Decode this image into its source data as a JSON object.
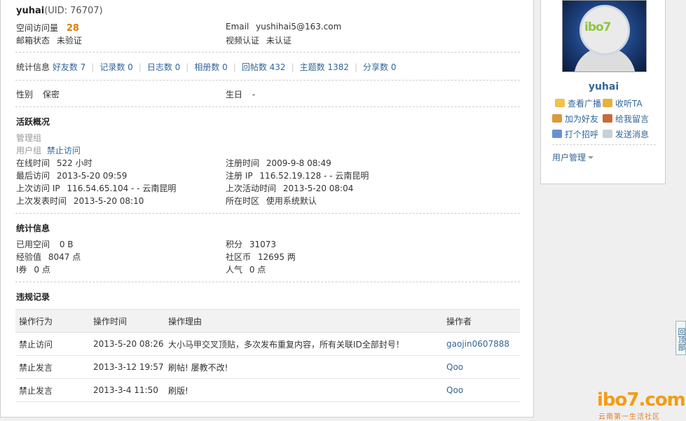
{
  "profile": {
    "username": "yuhai",
    "uid_text": "(UID: 76707)",
    "space_visits_label": "空间访问量",
    "space_visits_value": "28",
    "email_label": "Email",
    "email_value": "yushihai5@163.com",
    "email_status_label": "邮箱状态",
    "email_status_value": "未验证",
    "video_label": "视频认证",
    "video_value": "未认证"
  },
  "stats_line": {
    "label": "统计信息",
    "items": [
      "好友数 7",
      "记录数 0",
      "日志数 0",
      "相册数 0",
      "回帖数 432",
      "主题数 1382",
      "分享数 0"
    ]
  },
  "basic": {
    "gender_label": "性别",
    "gender_value": "保密",
    "birthday_label": "生日",
    "birthday_value": "-"
  },
  "activity": {
    "title": "活跃概况",
    "admin_group_label": "管理组",
    "user_group_label": "用户组",
    "user_group_value": "禁止访问",
    "online_label": "在线时间",
    "online_value": "522 小时",
    "register_label": "注册时间",
    "register_value": "2009-9-8 08:49",
    "last_visit_label": "最后访问",
    "last_visit_value": "2013-5-20 09:59",
    "register_ip_label": "注册 IP",
    "register_ip_value": "116.52.19.128 - - 云南昆明",
    "last_ip_label": "上次访问 IP",
    "last_ip_value": "116.54.65.104 - - 云南昆明",
    "last_active_label": "上次活动时间",
    "last_active_value": "2013-5-20 08:04",
    "last_post_label": "上次发表时间",
    "last_post_value": "2013-5-20 08:10",
    "timezone_label": "所在时区",
    "timezone_value": "使用系统默认"
  },
  "statistics": {
    "title": "统计信息",
    "used_space_label": "已用空间",
    "used_space_value": "0 B",
    "points_label": "积分",
    "points_value": "31073",
    "exp_label": "经验值",
    "exp_value": "8047 点",
    "coins_label": "社区币",
    "coins_value": "12695 两",
    "iquan_label": "I券",
    "iquan_value": "0 点",
    "popularity_label": "人气",
    "popularity_value": "0 点"
  },
  "violations": {
    "title": "违规记录",
    "headers": [
      "操作行为",
      "操作时间",
      "操作理由",
      "操作者"
    ],
    "rows": [
      {
        "action": "禁止访问",
        "time": "2013-5-20 08:26",
        "reason": "大小马甲交叉顶贴，多次发布重复内容，所有关联ID全部封号！",
        "operator": "gaojin0607888"
      },
      {
        "action": "禁止发言",
        "time": "2013-3-12 19:57",
        "reason": "刷帖! 屡教不改!",
        "operator": "Qoo"
      },
      {
        "action": "禁止发言",
        "time": "2013-3-4 11:50",
        "reason": "刷版!",
        "operator": "Qoo"
      }
    ]
  },
  "sidebar": {
    "avatar_logo": "ibo7",
    "username": "yuhai",
    "actions": [
      {
        "label": "查看广播",
        "icon": "broadcast-icon"
      },
      {
        "label": "收听TA",
        "icon": "follow-icon"
      },
      {
        "label": "加为好友",
        "icon": "add-friend-icon"
      },
      {
        "label": "给我留言",
        "icon": "message-pen-icon"
      },
      {
        "label": "打个招呼",
        "icon": "greet-icon"
      },
      {
        "label": "发送消息",
        "icon": "mail-icon"
      }
    ],
    "user_manage_label": "用户管理"
  },
  "back_to_top": "回顶部",
  "watermark": {
    "main": "ibo7.com",
    "sub": "云南第一生活社区"
  },
  "colors": {
    "link": "#336699",
    "accent_orange": "#e07b00"
  }
}
